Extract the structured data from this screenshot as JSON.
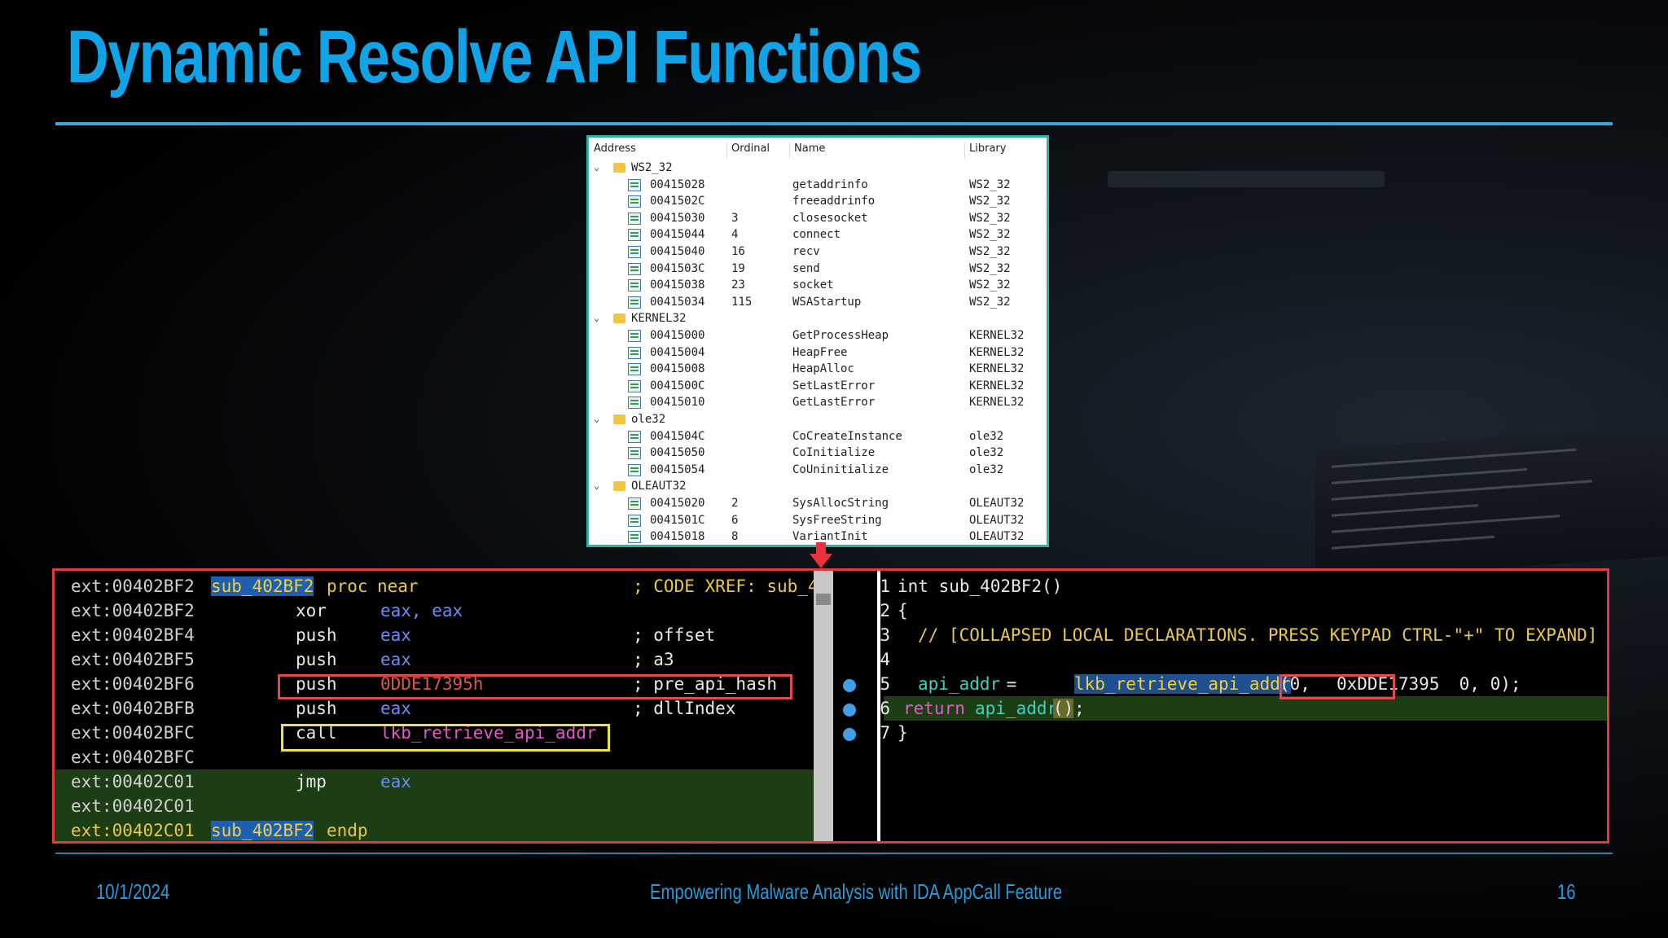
{
  "slide": {
    "title": "Dynamic Resolve API Functions",
    "date": "10/1/2024",
    "footer_text": "Empowering Malware Analysis with IDA AppCall Feature",
    "page_number": "16"
  },
  "imports": {
    "headers": [
      "Address",
      "Ordinal",
      "Name",
      "Library"
    ],
    "rows": [
      {
        "type": "group",
        "label": "WS2_32"
      },
      {
        "type": "item",
        "address": "00415028",
        "ordinal": "",
        "name": "getaddrinfo",
        "library": "WS2_32"
      },
      {
        "type": "item",
        "address": "0041502C",
        "ordinal": "",
        "name": "freeaddrinfo",
        "library": "WS2_32"
      },
      {
        "type": "item",
        "address": "00415030",
        "ordinal": "3",
        "name": "closesocket",
        "library": "WS2_32"
      },
      {
        "type": "item",
        "address": "00415044",
        "ordinal": "4",
        "name": "connect",
        "library": "WS2_32"
      },
      {
        "type": "item",
        "address": "00415040",
        "ordinal": "16",
        "name": "recv",
        "library": "WS2_32"
      },
      {
        "type": "item",
        "address": "0041503C",
        "ordinal": "19",
        "name": "send",
        "library": "WS2_32"
      },
      {
        "type": "item",
        "address": "00415038",
        "ordinal": "23",
        "name": "socket",
        "library": "WS2_32"
      },
      {
        "type": "item",
        "address": "00415034",
        "ordinal": "115",
        "name": "WSAStartup",
        "library": "WS2_32"
      },
      {
        "type": "group",
        "label": "KERNEL32"
      },
      {
        "type": "item",
        "address": "00415000",
        "ordinal": "",
        "name": "GetProcessHeap",
        "library": "KERNEL32"
      },
      {
        "type": "item",
        "address": "00415004",
        "ordinal": "",
        "name": "HeapFree",
        "library": "KERNEL32"
      },
      {
        "type": "item",
        "address": "00415008",
        "ordinal": "",
        "name": "HeapAlloc",
        "library": "KERNEL32"
      },
      {
        "type": "item",
        "address": "0041500C",
        "ordinal": "",
        "name": "SetLastError",
        "library": "KERNEL32"
      },
      {
        "type": "item",
        "address": "00415010",
        "ordinal": "",
        "name": "GetLastError",
        "library": "KERNEL32"
      },
      {
        "type": "group",
        "label": "ole32"
      },
      {
        "type": "item",
        "address": "0041504C",
        "ordinal": "",
        "name": "CoCreateInstance",
        "library": "ole32"
      },
      {
        "type": "item",
        "address": "00415050",
        "ordinal": "",
        "name": "CoInitialize",
        "library": "ole32"
      },
      {
        "type": "item",
        "address": "00415054",
        "ordinal": "",
        "name": "CoUninitialize",
        "library": "ole32"
      },
      {
        "type": "group",
        "label": "OLEAUT32"
      },
      {
        "type": "item",
        "address": "00415020",
        "ordinal": "2",
        "name": "SysAllocString",
        "library": "OLEAUT32"
      },
      {
        "type": "item",
        "address": "0041501C",
        "ordinal": "6",
        "name": "SysFreeString",
        "library": "OLEAUT32"
      },
      {
        "type": "item",
        "address": "00415018",
        "ordinal": "8",
        "name": "VariantInit",
        "library": "OLEAUT32"
      }
    ]
  },
  "disasm": {
    "lines": [
      {
        "addr": "ext:00402BF2",
        "label": "sub_402BF2",
        "mnem": "proc",
        "op": "near",
        "comment": "; CODE XREF: sub_4"
      },
      {
        "addr": "ext:00402BF2",
        "label": "",
        "mnem": "xor",
        "op": "eax, eax",
        "comment": ""
      },
      {
        "addr": "ext:00402BF4",
        "label": "",
        "mnem": "push",
        "op": "eax",
        "comment": "; offset"
      },
      {
        "addr": "ext:00402BF5",
        "label": "",
        "mnem": "push",
        "op": "eax",
        "comment": "; a3"
      },
      {
        "addr": "ext:00402BF6",
        "label": "",
        "mnem": "push",
        "op": "0DDE17395h",
        "comment": "; pre_api_hash"
      },
      {
        "addr": "ext:00402BFB",
        "label": "",
        "mnem": "push",
        "op": "eax",
        "comment": "; dllIndex"
      },
      {
        "addr": "ext:00402BFC",
        "label": "",
        "mnem": "call",
        "op": "lkb_retrieve_api_addr",
        "comment": ""
      },
      {
        "addr": "ext:00402BFC",
        "label": "",
        "mnem": "",
        "op": "",
        "comment": ""
      },
      {
        "addr": "ext:00402C01",
        "label": "",
        "mnem": "jmp",
        "op": "eax",
        "comment": ""
      },
      {
        "addr": "ext:00402C01",
        "label": "",
        "mnem": "",
        "op": "",
        "comment": ""
      },
      {
        "addr": "ext:00402C01",
        "label": "sub_402BF2",
        "mnem": "endp",
        "op": "",
        "comment": ""
      }
    ]
  },
  "pseudocode": {
    "line_numbers": [
      "1",
      "2",
      "3",
      "4",
      "5",
      "6",
      "7"
    ],
    "l1": "int sub_402BF2()",
    "l2": "{",
    "l3": "// [COLLAPSED LOCAL DECLARATIONS. PRESS KEYPAD CTRL-\"+\" TO EXPAND]",
    "l5_var": "api_addr",
    "l5_eq": " = ",
    "l5_func": "lkb_retrieve_api_addr",
    "l5_open": "(0, ",
    "l5_hash": "0xDDE17395",
    "l5_rest": " 0, 0);",
    "l6_kw": "return",
    "l6_var": "api_addr",
    "l6_call": "()",
    "l6_semi": ";",
    "l7": "}"
  },
  "colors": {
    "title": "#12a3e6",
    "highlight_box_red": "#e04a4a",
    "highlight_box_yellow": "#f0e040",
    "panel_border": "#e03a40"
  }
}
